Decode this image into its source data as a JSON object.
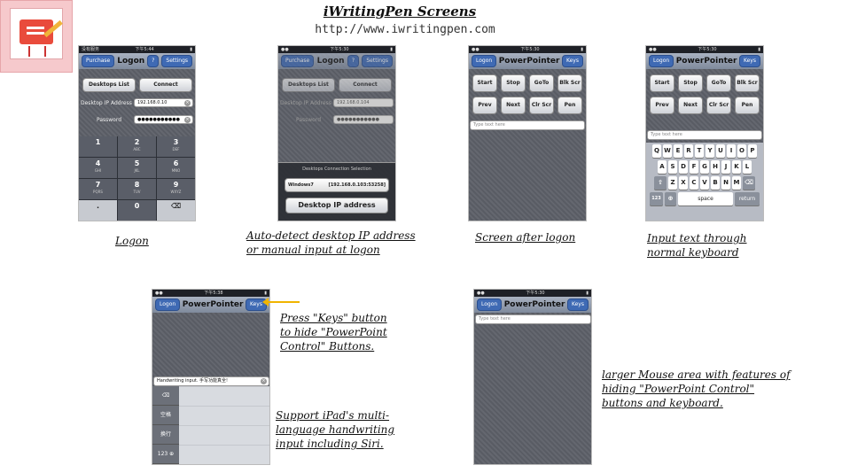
{
  "header": {
    "title": "iWritingPen Screens",
    "url": "http://www.iwritingpen.com"
  },
  "screen1": {
    "status_left": "没有服务",
    "status_time": "下午5:44",
    "nav_left": "Purchase",
    "nav_title": "Logon",
    "nav_help": "?",
    "nav_right": "Settings",
    "desktops_list": "Desktops List",
    "connect": "Connect",
    "ip_label": "Desktop IP Address",
    "ip_value": "192.168.0.10",
    "password_label": "Password",
    "password_value": "●●●●●●●●●●●",
    "keys": [
      {
        "num": "1",
        "letters": ""
      },
      {
        "num": "2",
        "letters": "ABC"
      },
      {
        "num": "3",
        "letters": "DEF"
      },
      {
        "num": "4",
        "letters": "GHI"
      },
      {
        "num": "5",
        "letters": "JKL"
      },
      {
        "num": "6",
        "letters": "MNO"
      },
      {
        "num": "7",
        "letters": "PQRS"
      },
      {
        "num": "8",
        "letters": "TUV"
      },
      {
        "num": "9",
        "letters": "WXYZ"
      },
      {
        "num": ".",
        "letters": ""
      },
      {
        "num": "0",
        "letters": ""
      },
      {
        "num": "⌫",
        "letters": ""
      }
    ],
    "caption": "Logon"
  },
  "screen2": {
    "status_time": "下午5:30",
    "nav_left": "Purchase",
    "nav_title": "Logon",
    "nav_help": "?",
    "nav_right": "Settings",
    "desktops_list": "Desktops List",
    "connect": "Connect",
    "ip_label": "Desktop IP Address",
    "ip_value": "192.168.0.104",
    "password_label": "Password",
    "password_value": "●●●●●●●●●●●",
    "sheet_title": "Desktops Connection Selection",
    "option_name": "Windows7",
    "option_addr": "[192.168.0.103:53258]",
    "option_manual": "Desktop IP address",
    "caption_line1": "Auto-detect desktop IP address",
    "caption_line2": "or manual input at logon"
  },
  "screen3": {
    "status_time": "下午5:30",
    "nav_left": "Logon",
    "nav_title": "PowerPointer",
    "nav_right": "Keys",
    "buttons": [
      "Start",
      "Stop",
      "GoTo",
      "Blk Scr",
      "Prev",
      "Next",
      "Clr Scr",
      "Pen"
    ],
    "input_placeholder": "Type text here",
    "caption": "Screen after logon"
  },
  "screen4": {
    "status_time": "下午5:30",
    "nav_left": "Logon",
    "nav_title": "PowerPointer",
    "nav_right": "Keys",
    "buttons": [
      "Start",
      "Stop",
      "GoTo",
      "Blk Scr",
      "Prev",
      "Next",
      "Clr Scr",
      "Pen"
    ],
    "input_placeholder": "Type text here",
    "row1": [
      "Q",
      "W",
      "E",
      "R",
      "T",
      "Y",
      "U",
      "I",
      "O",
      "P"
    ],
    "row2": [
      "A",
      "S",
      "D",
      "F",
      "G",
      "H",
      "J",
      "K",
      "L"
    ],
    "row3": [
      "Z",
      "X",
      "C",
      "V",
      "B",
      "N",
      "M"
    ],
    "num_key": "123",
    "globe_key": "⊕",
    "space_key": "space",
    "return_key": "return",
    "shift_key": "⇧",
    "delete_key": "⌫",
    "caption_line1": "Input text through",
    "caption_line2": "normal keyboard"
  },
  "screen5": {
    "status_time": "下午5:38",
    "nav_left": "Logon",
    "nav_title": "PowerPointer",
    "nav_right": "Keys",
    "input_value": "Handwriting input. 手写功能真全!",
    "side_keys": [
      "⌫",
      "空格",
      "换行",
      "123 ⊕"
    ],
    "note_line1": "Press \"Keys\" button",
    "note_line2": "to hide \"PowerPoint",
    "note_line3": "Control\" Buttons.",
    "caption_line1": "Support iPad's multi-",
    "caption_line2": "language handwriting",
    "caption_line3": "input including Siri."
  },
  "screen6": {
    "status_time": "下午5:30",
    "nav_left": "Logon",
    "nav_title": "PowerPointer",
    "nav_right": "Keys",
    "input_placeholder": "Type text here",
    "caption_line1": "larger Mouse area with features of",
    "caption_line2": "hiding \"PowerPoint Control\"",
    "caption_line3": "buttons and keyboard."
  }
}
